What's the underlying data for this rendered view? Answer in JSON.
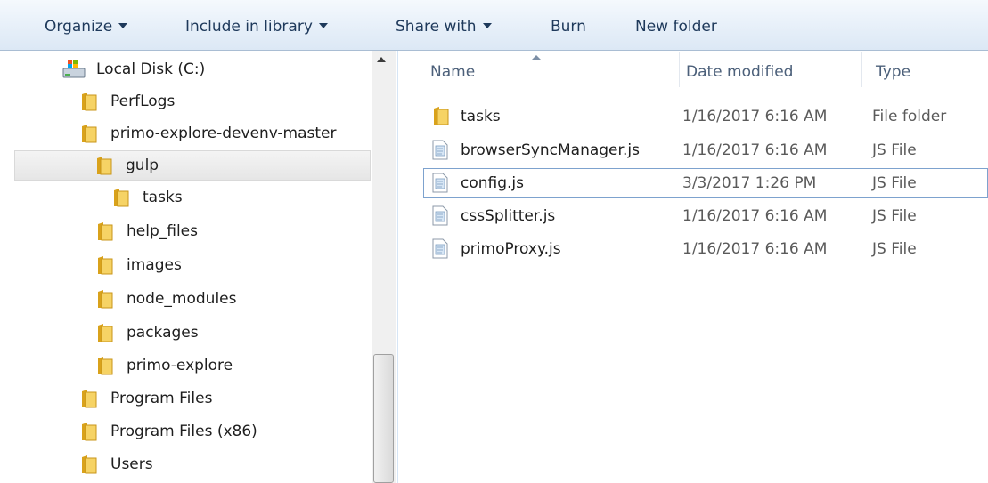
{
  "toolbar": {
    "organize": "Organize",
    "include_in_library": "Include in library",
    "share_with": "Share with",
    "burn": "Burn",
    "new_folder": "New folder"
  },
  "nav": {
    "items": [
      {
        "label": "Local Disk (C:)",
        "icon": "drive-icon"
      },
      {
        "label": "PerfLogs",
        "icon": "folder-icon"
      },
      {
        "label": "primo-explore-devenv-master",
        "icon": "folder-icon"
      },
      {
        "label": "gulp",
        "icon": "folder-icon",
        "selected": true
      },
      {
        "label": "tasks",
        "icon": "folder-icon"
      },
      {
        "label": "help_files",
        "icon": "folder-icon"
      },
      {
        "label": "images",
        "icon": "folder-icon"
      },
      {
        "label": "node_modules",
        "icon": "folder-icon"
      },
      {
        "label": "packages",
        "icon": "folder-icon"
      },
      {
        "label": "primo-explore",
        "icon": "folder-icon"
      },
      {
        "label": "Program Files",
        "icon": "folder-icon"
      },
      {
        "label": "Program Files (x86)",
        "icon": "folder-icon"
      },
      {
        "label": "Users",
        "icon": "folder-icon"
      }
    ]
  },
  "columns": {
    "name": "Name",
    "date_modified": "Date modified",
    "type": "Type"
  },
  "files": [
    {
      "name": "tasks",
      "date": "1/16/2017 6:16 AM",
      "type": "File folder",
      "icon": "folder-icon"
    },
    {
      "name": "browserSyncManager.js",
      "date": "1/16/2017 6:16 AM",
      "type": "JS File",
      "icon": "js-file-icon"
    },
    {
      "name": "config.js",
      "date": "3/3/2017 1:26 PM",
      "type": "JS File",
      "icon": "js-file-icon",
      "focused": true
    },
    {
      "name": "cssSplitter.js",
      "date": "1/16/2017 6:16 AM",
      "type": "JS File",
      "icon": "js-file-icon"
    },
    {
      "name": "primoProxy.js",
      "date": "1/16/2017 6:16 AM",
      "type": "JS File",
      "icon": "js-file-icon"
    }
  ],
  "colors": {
    "toolbar_text": "#1e395b",
    "selected_bg": "#e9e9e9",
    "focus_border": "#7da2ce",
    "folder_yellow": "#f2c94c"
  }
}
